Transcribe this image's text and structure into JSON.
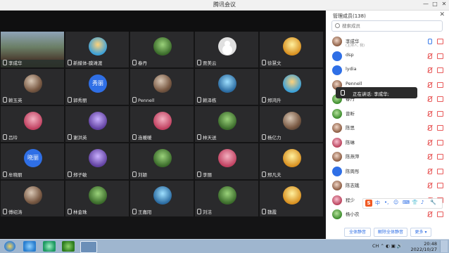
{
  "window": {
    "title": "腾讯会议",
    "minimize": "—",
    "maximize": "□",
    "close": "✕"
  },
  "tiles": [
    {
      "name": "李成华",
      "type": "main",
      "mic": true
    },
    {
      "name": "新媒体-膜滩渡",
      "type": "c1"
    },
    {
      "name": "春丹",
      "type": "c2"
    },
    {
      "name": "贾美云",
      "type": "grey"
    },
    {
      "name": "徐慧文",
      "type": "c5"
    },
    {
      "name": "赖玉英",
      "type": "photo"
    },
    {
      "name": "郭秀丽",
      "type": "text",
      "text": "秀丽"
    },
    {
      "name": "Pennell",
      "type": "photo"
    },
    {
      "name": "赖泽栋",
      "type": "c6"
    },
    {
      "name": "郑鸿升",
      "type": "c1"
    },
    {
      "name": "吕玲",
      "type": "c3"
    },
    {
      "name": "谢洪英",
      "type": "c4"
    },
    {
      "name": "连暖暖",
      "type": "c3"
    },
    {
      "name": "林天送",
      "type": "c2"
    },
    {
      "name": "杨亿力",
      "type": "photo"
    },
    {
      "name": "牟晓丽",
      "type": "text",
      "text": "晓丽"
    },
    {
      "name": "郑子敏",
      "type": "c4"
    },
    {
      "name": "刘颖",
      "type": "c2"
    },
    {
      "name": "李丽",
      "type": "c3"
    },
    {
      "name": "邢凡夫",
      "type": "c5"
    },
    {
      "name": "傅绍涛",
      "type": "photo"
    },
    {
      "name": "林金珠",
      "type": "c2"
    },
    {
      "name": "王嘉阳",
      "type": "c6"
    },
    {
      "name": "刘洁",
      "type": "c2"
    },
    {
      "name": "魏霞",
      "type": "c5"
    }
  ],
  "panel": {
    "title": "管理成员(138)",
    "close": "✕",
    "search_placeholder": "搜索成员",
    "members": [
      {
        "name": "李成华",
        "sub": "(主持人, 我)",
        "av": "ph",
        "mic_on": true
      },
      {
        "name": "dsp",
        "av": "blue"
      },
      {
        "name": "lydia",
        "av": "blue"
      },
      {
        "name": "Pennell",
        "av": "ph"
      },
      {
        "name": "春丹",
        "av": "gr"
      },
      {
        "name": "曾昕",
        "av": "gr"
      },
      {
        "name": "陈思",
        "av": "ph"
      },
      {
        "name": "陈琳",
        "av": "pk"
      },
      {
        "name": "陈燕萍",
        "av": "ph"
      },
      {
        "name": "陈周彤",
        "av": "blue"
      },
      {
        "name": "陈志娥",
        "av": "ph"
      },
      {
        "name": "程少",
        "av": "pk"
      },
      {
        "name": "杨小农",
        "av": "gr"
      }
    ],
    "speaking_text": "正在讲话: 李成华;",
    "btn_mute_all": "全体静音",
    "btn_unmute_all": "解除全体静音",
    "btn_more": "更多 ▾"
  },
  "ime": {
    "logo": "S",
    "items": [
      "中",
      "•,",
      "☺",
      "⌨",
      "👕",
      "♪",
      "🔧"
    ]
  },
  "taskbar": {
    "tray": "CH ⌃ ◐ ▣ 🔊",
    "time": "20:48",
    "date": "2022/10/27"
  }
}
